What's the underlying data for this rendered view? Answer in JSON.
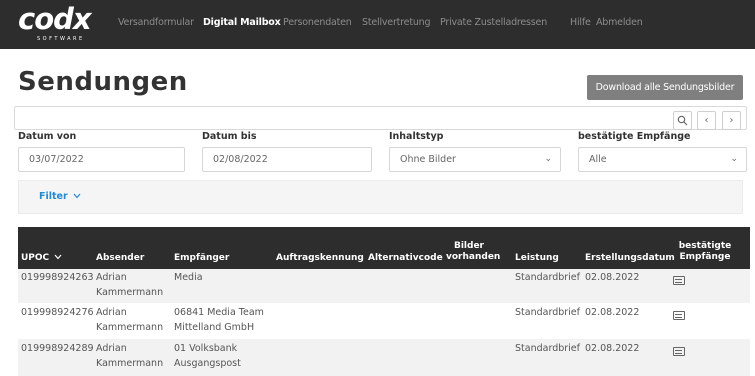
{
  "brand": {
    "name": "codx",
    "tagline": "SOFTWARE"
  },
  "nav": [
    {
      "label": "Versandformular",
      "active": false
    },
    {
      "label": "Digital Mailbox",
      "active": true
    },
    {
      "label": "Personendaten",
      "active": false
    },
    {
      "label": "Stellvertretung",
      "active": false
    },
    {
      "label": "Private Zustelladressen",
      "active": false
    },
    {
      "label": "Hilfe",
      "active": false
    },
    {
      "label": "Abmelden",
      "active": false
    }
  ],
  "page": {
    "title": "Sendungen",
    "download_label": "Download alle Sendungsbilder"
  },
  "search": {
    "value": "",
    "search_icon": "search-icon",
    "prev_icon": "chevron-left-icon",
    "next_icon": "chevron-right-icon"
  },
  "filters": {
    "datum_von": {
      "label": "Datum von",
      "value": "03/07/2022"
    },
    "datum_bis": {
      "label": "Datum bis",
      "value": "02/08/2022"
    },
    "inhaltstyp": {
      "label": "Inhaltstyp",
      "value": "Ohne Bilder"
    },
    "empfaenger": {
      "label": "bestätigte Empfänge",
      "value": "Alle"
    },
    "toggle_label": "Filter",
    "toggle_icon": "chevron-down-icon"
  },
  "table": {
    "columns": [
      "UPOC",
      "Absender",
      "Empfänger",
      "Auftragskennung",
      "Alternativcode",
      "Bilder vorhanden",
      "Leistung",
      "Erstellungsdatum",
      "bestätigte Empfänge"
    ],
    "sort_icon": "chevron-down-icon",
    "rows": [
      {
        "upoc": "019998924263",
        "absender": "Adrian Kammermann",
        "empfaenger": "Media",
        "auftragskennung": "",
        "alternativcode": "",
        "bilder": "",
        "leistung": "Standardbrief",
        "datum": "02.08.2022",
        "icon": "envelope-icon"
      },
      {
        "upoc": "019998924276",
        "absender": "Adrian Kammermann",
        "empfaenger": "06841 Media Team Mittelland GmbH",
        "auftragskennung": "",
        "alternativcode": "",
        "bilder": "",
        "leistung": "Standardbrief",
        "datum": "02.08.2022",
        "icon": "envelope-icon"
      },
      {
        "upoc": "019998924289",
        "absender": "Adrian Kammermann",
        "empfaenger": "01 Volksbank Ausgangspost",
        "auftragskennung": "",
        "alternativcode": "",
        "bilder": "",
        "leistung": "Standardbrief",
        "datum": "02.08.2022",
        "icon": "envelope-icon"
      }
    ]
  },
  "colors": {
    "navbar": "#2d2d2d",
    "accent": "#1f8ad6",
    "button": "#7f7f7f"
  }
}
